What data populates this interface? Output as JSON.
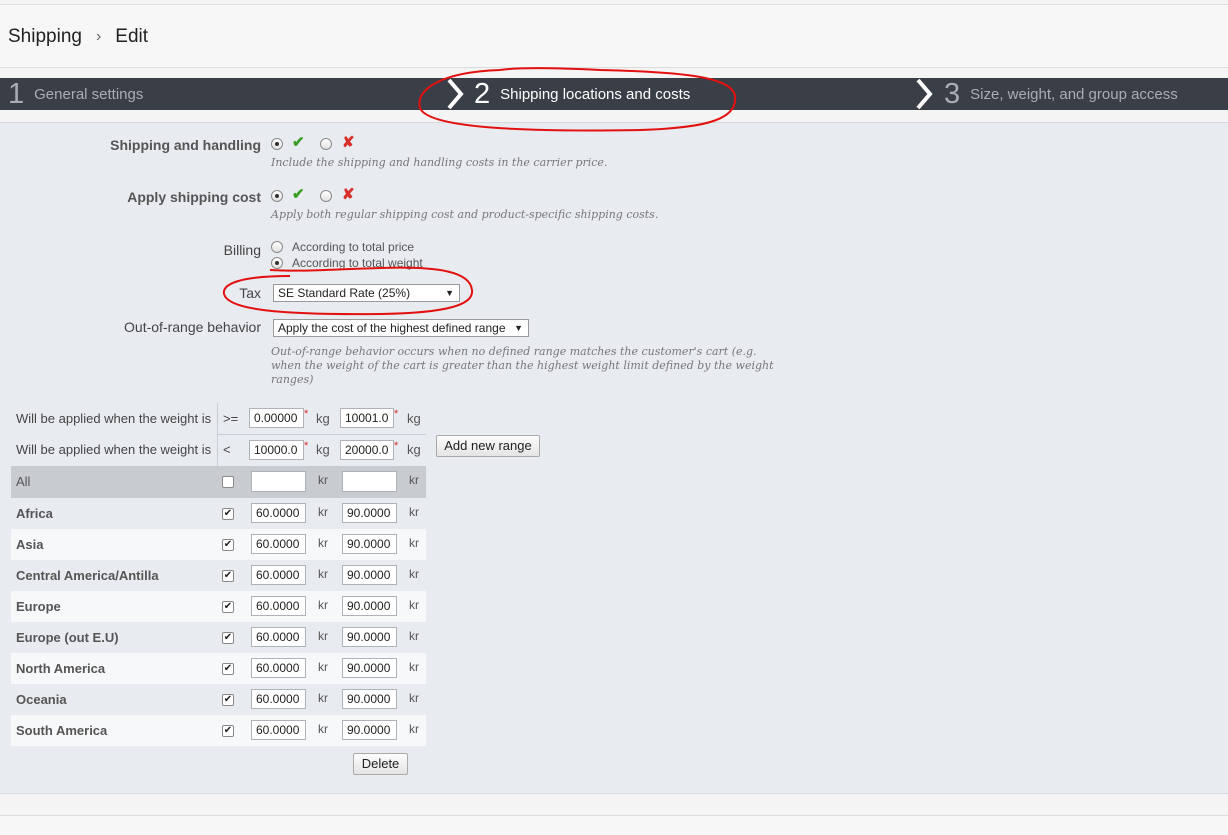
{
  "breadcrumb": {
    "section": "Shipping",
    "separator": "›",
    "page": "Edit"
  },
  "steps": [
    {
      "num": "1",
      "label": "General settings"
    },
    {
      "num": "2",
      "label": "Shipping locations and costs"
    },
    {
      "num": "3",
      "label": "Size, weight, and group access"
    }
  ],
  "form": {
    "shipping_handling": {
      "label": "Shipping and handling",
      "hint": "Include the shipping and handling costs in the carrier price.",
      "yes": "✔",
      "no": "✘"
    },
    "apply_cost": {
      "label": "Apply shipping cost",
      "hint": "Apply both regular shipping cost and product-specific shipping costs.",
      "yes": "✔",
      "no": "✘"
    },
    "billing": {
      "label": "Billing",
      "options": [
        "According to total price",
        "According to total weight"
      ],
      "selected": "According to total weight"
    },
    "tax": {
      "label": "Tax",
      "value": "SE Standard Rate (25%)",
      "arrow": "▼"
    },
    "out_of_range": {
      "label": "Out-of-range behavior",
      "value": "Apply the cost of the highest defined range",
      "arrow": "▼",
      "hint_lines": [
        "Out-of-range behavior occurs when no defined range matches the customer's cart (e.g.",
        "when the weight of the cart is greater than the highest weight limit defined by the weight",
        "ranges)"
      ]
    }
  },
  "ranges": {
    "rows": [
      {
        "label": "Will be applied when the weight is",
        "op": ">=",
        "v1": "0.00000",
        "v2": "10001.0",
        "unit": "kg"
      },
      {
        "label": "Will be applied when the weight is",
        "op": "<",
        "v1": "10000.0",
        "v2": "20000.0",
        "unit": "kg"
      }
    ],
    "required_mark": "*",
    "add_button": "Add new range"
  },
  "zones": {
    "all_label": "All",
    "currency": "kr",
    "items": [
      {
        "name": "Africa",
        "checked": true,
        "p1": "60.0000",
        "p2": "90.0000"
      },
      {
        "name": "Asia",
        "checked": true,
        "p1": "60.0000",
        "p2": "90.0000"
      },
      {
        "name": "Central America/Antilla",
        "checked": true,
        "p1": "60.0000",
        "p2": "90.0000"
      },
      {
        "name": "Europe",
        "checked": true,
        "p1": "60.0000",
        "p2": "90.0000"
      },
      {
        "name": "Europe (out E.U)",
        "checked": true,
        "p1": "60.0000",
        "p2": "90.0000"
      },
      {
        "name": "North America",
        "checked": true,
        "p1": "60.0000",
        "p2": "90.0000"
      },
      {
        "name": "Oceania",
        "checked": true,
        "p1": "60.0000",
        "p2": "90.0000"
      },
      {
        "name": "South America",
        "checked": true,
        "p1": "60.0000",
        "p2": "90.0000"
      }
    ],
    "delete_button": "Delete"
  },
  "colors": {
    "step_bar": "#3a3f47",
    "content_bg": "#e8ebf0",
    "annotation": "#e31010",
    "check_green": "#3a9d23",
    "cross_red": "#d9302c"
  }
}
